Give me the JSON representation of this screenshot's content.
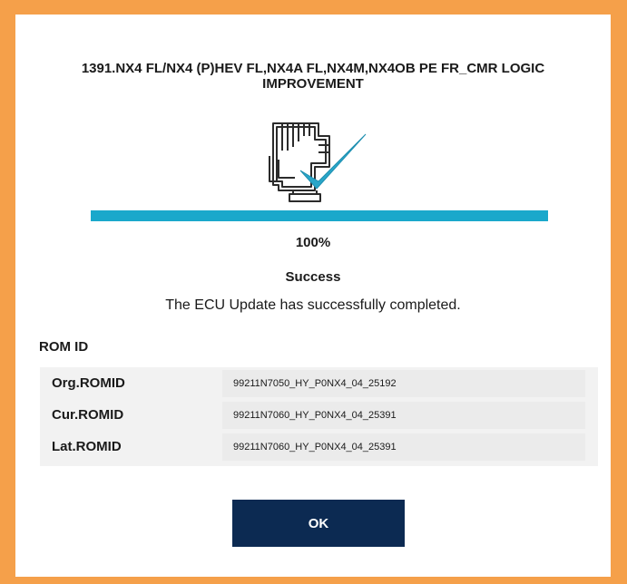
{
  "dialog": {
    "title": "1391.NX4 FL/NX4 (P)HEV FL,NX4A FL,NX4M,NX4OB PE FR_CMR LOGIC IMPROVEMENT",
    "icon": "ecu-update-success-icon",
    "progress": {
      "percent_value": 100,
      "label": "100%"
    },
    "status": {
      "title": "Success",
      "message": "The ECU Update has successfully completed."
    },
    "rom_id": {
      "heading": "ROM ID",
      "rows": [
        {
          "label": "Org.ROMID",
          "value": "99211N7050_HY_P0NX4_04_25192"
        },
        {
          "label": "Cur.ROMID",
          "value": "99211N7060_HY_P0NX4_04_25391"
        },
        {
          "label": "Lat.ROMID",
          "value": "99211N7060_HY_P0NX4_04_25391"
        }
      ]
    },
    "ok_label": "OK"
  },
  "colors": {
    "frame": "#f5a04a",
    "progress": "#1aa8cb",
    "check": "#29a6c8",
    "button": "#0c2a52"
  }
}
